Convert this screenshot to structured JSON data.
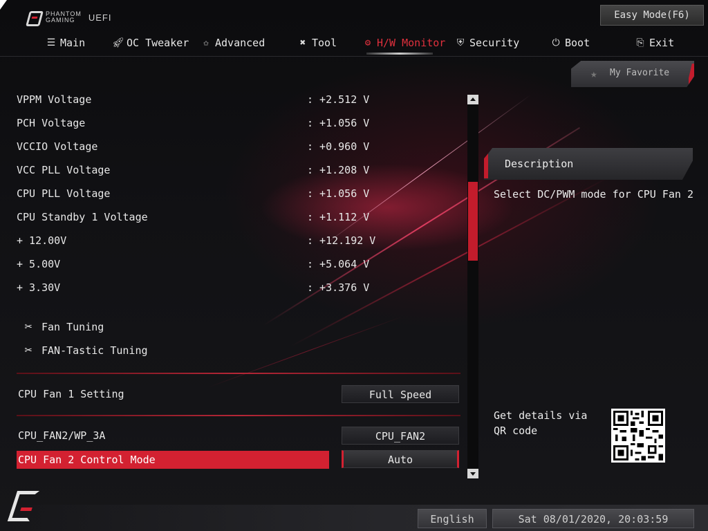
{
  "header": {
    "logo_line1": "PHANTOM",
    "logo_line2": "GAMING",
    "logo_uefi": "UEFI",
    "easy_mode_label": "Easy Mode(F6)"
  },
  "nav": {
    "items": [
      {
        "label": "Main",
        "icon": "list-icon"
      },
      {
        "label": "OC Tweaker",
        "icon": "rocket-icon"
      },
      {
        "label": "Advanced",
        "icon": "star-icon"
      },
      {
        "label": "Tool",
        "icon": "tools-icon"
      },
      {
        "label": "H/W Monitor",
        "icon": "monitor-icon"
      },
      {
        "label": "Security",
        "icon": "shield-icon"
      },
      {
        "label": "Boot",
        "icon": "power-icon"
      },
      {
        "label": "Exit",
        "icon": "exit-icon"
      }
    ],
    "active": "H/W Monitor"
  },
  "favorite": {
    "label": "My Favorite"
  },
  "voltages": [
    {
      "label": "VPPM Voltage",
      "value": ": +2.512 V"
    },
    {
      "label": "PCH Voltage",
      "value": ": +1.056 V"
    },
    {
      "label": "VCCIO Voltage",
      "value": ": +0.960 V"
    },
    {
      "label": "VCC PLL Voltage",
      "value": ": +1.208 V"
    },
    {
      "label": "CPU PLL Voltage",
      "value": ": +1.056 V"
    },
    {
      "label": "CPU Standby 1 Voltage",
      "value": ": +1.112 V"
    },
    {
      "label": "+ 12.00V",
      "value": ": +12.192 V"
    },
    {
      "label": "+ 5.00V",
      "value": ": +5.064 V"
    },
    {
      "label": "+ 3.30V",
      "value": ": +3.376 V"
    }
  ],
  "tools": [
    {
      "label": "Fan Tuning",
      "icon": "wrench-screwdriver-icon"
    },
    {
      "label": "FAN-Tastic Tuning",
      "icon": "wrench-screwdriver-icon"
    }
  ],
  "settings": {
    "cpu_fan1": {
      "label": "CPU Fan 1 Setting",
      "value": "Full Speed"
    },
    "cpu_fan2_wp": {
      "label": "CPU_FAN2/WP_3A",
      "value": "CPU_FAN2"
    },
    "cpu_fan2_mode": {
      "label": "CPU Fan 2 Control Mode",
      "value": "Auto"
    }
  },
  "description": {
    "title": "Description",
    "text": "Select DC/PWM mode for CPU Fan 2"
  },
  "qr": {
    "text": "Get details via QR code"
  },
  "footer": {
    "language": "English",
    "datetime": "Sat 08/01/2020, 20:03:59"
  },
  "colors": {
    "accent": "#d32131",
    "background": "#111114"
  }
}
